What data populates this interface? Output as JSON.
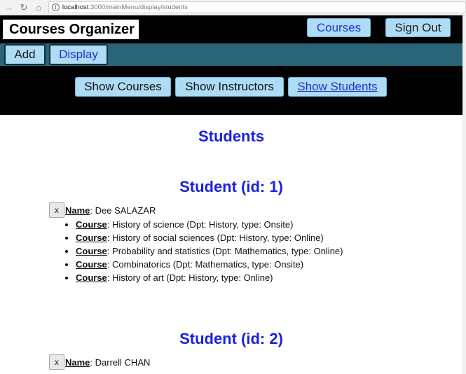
{
  "browser": {
    "url_host": "localhost",
    "url_path": ":3000/mainMenu/display/students"
  },
  "header": {
    "title": "Courses Organizer",
    "courses_label": "Courses",
    "signout_label": "Sign Out"
  },
  "menu": {
    "add_label": "Add",
    "display_label": "Display"
  },
  "submenu": {
    "show_courses": "Show Courses",
    "show_instructors": "Show Instructors",
    "show_students": "Show Students"
  },
  "page_title": "Students",
  "name_label": "Name",
  "course_label": "Course",
  "delete_label": "x",
  "students": [
    {
      "heading": "Student (id: 1)",
      "name": ": Dee SALAZAR",
      "courses": [
        ": History of science (Dpt: History, type: Onsite)",
        ": History of social sciences (Dpt: History, type: Online)",
        ": Probability and statistics (Dpt: Mathematics, type: Online)",
        ": Combinatorics (Dpt: Mathematics, type: Onsite)",
        ": History of art (Dpt: History, type: Online)"
      ]
    },
    {
      "heading": "Student (id: 2)",
      "name": ": Darrell CHAN",
      "courses": []
    }
  ]
}
